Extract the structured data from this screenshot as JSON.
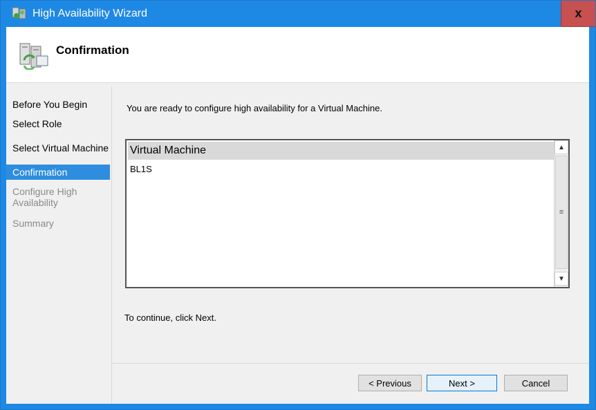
{
  "window": {
    "title": "High Availability Wizard",
    "close_label": "x"
  },
  "header": {
    "title": "Confirmation"
  },
  "nav": {
    "items": [
      {
        "label": "Before You Begin",
        "state": "normal"
      },
      {
        "label": "Select Role",
        "state": "normal"
      },
      {
        "label": "Select Virtual Machine",
        "state": "normal"
      },
      {
        "label": "Confirmation",
        "state": "active"
      },
      {
        "label": "Configure High Availability",
        "state": "disabled"
      },
      {
        "label": "Summary",
        "state": "disabled"
      }
    ]
  },
  "main": {
    "intro": "You are ready to configure high availability for a Virtual Machine.",
    "list": {
      "column_header": "Virtual Machine",
      "rows": [
        "BL1S"
      ]
    },
    "continue_text": "To continue, click Next."
  },
  "buttons": {
    "previous": "< Previous",
    "next": "Next >",
    "cancel": "Cancel"
  },
  "colors": {
    "titlebar": "#1e88e5",
    "close": "#c75050",
    "nav_active": "#2e8ddf"
  }
}
